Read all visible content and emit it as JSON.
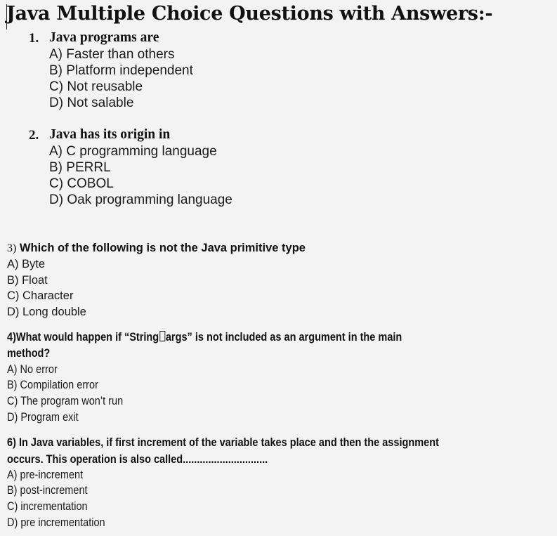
{
  "document": {
    "title": "Java Multiple Choice Questions with Answers:-",
    "questions": [
      {
        "number": "1.",
        "text": "Java programs are",
        "options": [
          "A) Faster than others",
          "B) Platform independent",
          "C) Not reusable",
          "D) Not salable"
        ]
      },
      {
        "number": "2.",
        "text": "Java has its origin in",
        "options": [
          "A) C programming language",
          "B) PERRL",
          "C) COBOL",
          "D) Oak programming language"
        ]
      },
      {
        "number": "3)",
        "text": "Which of the following is not the Java primitive type",
        "options": [
          "A) Byte",
          "B) Float",
          "C) Character",
          "D) Long double"
        ]
      },
      {
        "number": "4)",
        "text_before": "What would happen if “String",
        "text_after": "args” is not included as an argument in the main",
        "text_line2": "method?",
        "options": [
          "A) No error",
          "B) Compilation error",
          "C) The program won’t run",
          "D) Program exit"
        ]
      },
      {
        "number": "6)",
        "text": "In Java variables, if first increment of the variable takes place and then the assignment",
        "text_line2": "occurs. This operation is also called..............................",
        "options": [
          "A) pre-increment",
          "B) post-increment",
          "C) incrementation",
          "D) pre incrementation"
        ]
      }
    ]
  }
}
